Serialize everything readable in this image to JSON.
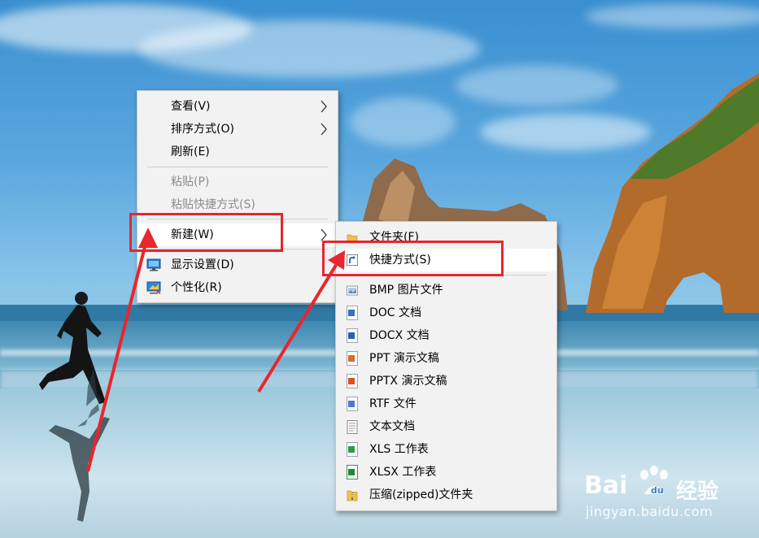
{
  "context_menu": {
    "items": [
      {
        "label": "查看(V)",
        "has_submenu": true,
        "enabled": true
      },
      {
        "label": "排序方式(O)",
        "has_submenu": true,
        "enabled": true
      },
      {
        "label": "刷新(E)",
        "has_submenu": false,
        "enabled": true
      },
      {
        "label": "粘贴(P)",
        "has_submenu": false,
        "enabled": false
      },
      {
        "label": "粘贴快捷方式(S)",
        "has_submenu": false,
        "enabled": false
      },
      {
        "label": "新建(W)",
        "has_submenu": true,
        "enabled": true,
        "highlighted": true
      },
      {
        "label": "显示设置(D)",
        "icon": "display-settings-icon",
        "enabled": true
      },
      {
        "label": "个性化(R)",
        "icon": "personalize-icon",
        "enabled": true
      }
    ]
  },
  "new_submenu": {
    "items": [
      {
        "label": "文件夹(F)",
        "icon": "folder-icon"
      },
      {
        "label": "快捷方式(S)",
        "icon": "shortcut-icon",
        "highlighted": true
      },
      {
        "label": "BMP 图片文件",
        "icon": "bmp-file-icon"
      },
      {
        "label": "DOC 文档",
        "icon": "doc-file-icon"
      },
      {
        "label": "DOCX 文档",
        "icon": "docx-file-icon"
      },
      {
        "label": "PPT 演示文稿",
        "icon": "ppt-file-icon"
      },
      {
        "label": "PPTX 演示文稿",
        "icon": "pptx-file-icon"
      },
      {
        "label": "RTF 文件",
        "icon": "rtf-file-icon"
      },
      {
        "label": "文本文档",
        "icon": "txt-file-icon"
      },
      {
        "label": "XLS 工作表",
        "icon": "xls-file-icon"
      },
      {
        "label": "XLSX 工作表",
        "icon": "xlsx-file-icon"
      },
      {
        "label": "压缩(zipped)文件夹",
        "icon": "zip-folder-icon"
      }
    ]
  },
  "watermark": {
    "brand_left": "Bai",
    "brand_right": "经验",
    "url": "jingyan.baidu.com"
  },
  "colors": {
    "annotation_red": "#e8262d",
    "menu_bg": "#f2f2f2",
    "disabled_text": "#8c8c8c"
  }
}
